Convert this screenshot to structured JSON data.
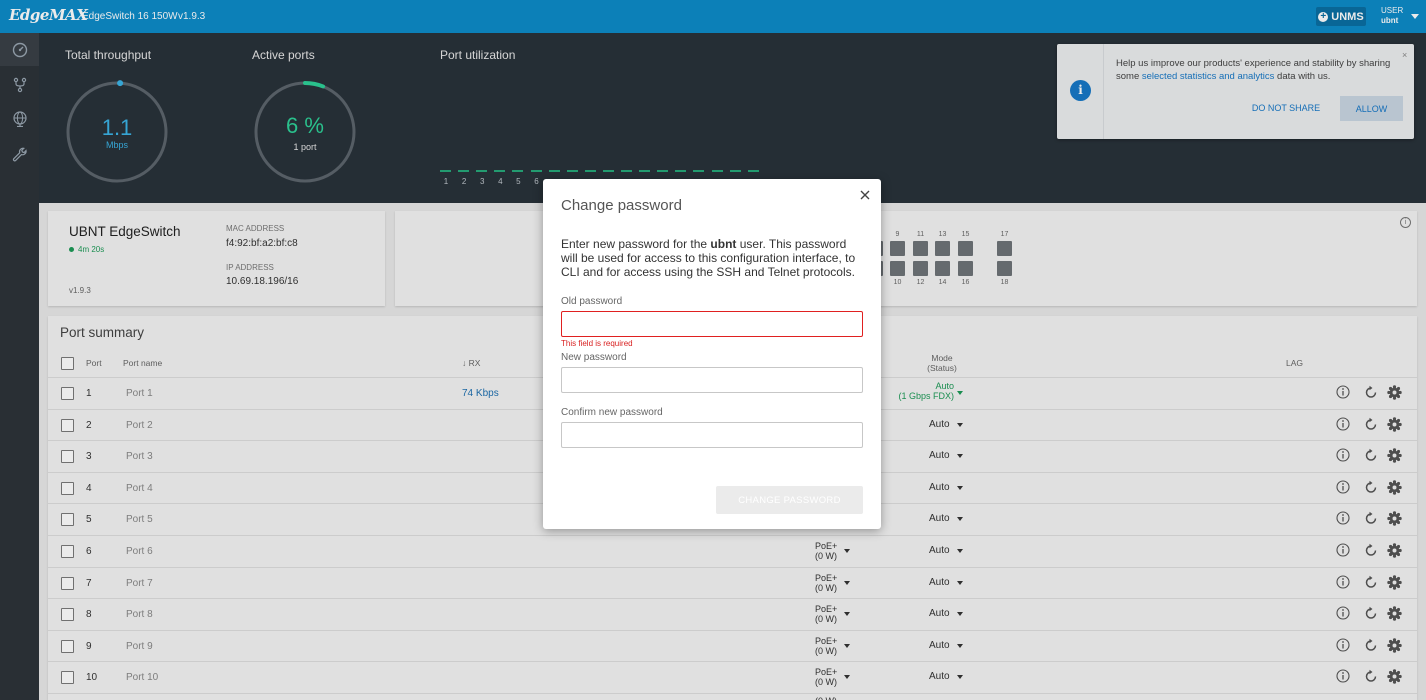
{
  "header": {
    "logo": "EdgeMAX",
    "model": "EdgeSwitch 16 150W",
    "version": "v1.9.3",
    "unms_label": "UNMS",
    "user_label": "USER",
    "username": "ubnt"
  },
  "sidebar": {
    "items": [
      {
        "icon": "dashboard-gauge-icon",
        "active": true
      },
      {
        "icon": "network-branch-icon",
        "active": false
      },
      {
        "icon": "globe-icon",
        "active": false
      },
      {
        "icon": "wrench-icon",
        "active": false
      }
    ]
  },
  "dashboard": {
    "throughput": {
      "title": "Total throughput",
      "value": "1.1",
      "unit": "Mbps",
      "fraction": 0.01
    },
    "active_ports": {
      "title": "Active ports",
      "value": "6 %",
      "sub": "1 port",
      "fraction": 0.06
    },
    "port_utilization": {
      "title": "Port utilization",
      "visible_ports": [
        "1",
        "2",
        "3",
        "4",
        "5",
        "6"
      ],
      "bar_count": 18
    }
  },
  "notification": {
    "text_before": "Help us improve our products' experience and stability by sharing some ",
    "link": "selected statistics and analytics",
    "text_after": " data with us.",
    "deny_label": "DO NOT SHARE",
    "allow_label": "ALLOW",
    "close": "×"
  },
  "device": {
    "name": "UBNT EdgeSwitch",
    "uptime": "4m 20s",
    "version": "v1.9.3",
    "mac_label": "MAC ADDRESS",
    "mac": "f4:92:bf:a2:bf:c8",
    "ip_label": "IP ADDRESS",
    "ip": "10.69.18.196/16"
  },
  "port_map": {
    "top_labels": [
      "9",
      "11",
      "13",
      "15",
      "17"
    ],
    "bottom_labels": [
      "10",
      "12",
      "14",
      "16",
      "18"
    ]
  },
  "port_summary": {
    "title": "Port summary",
    "columns": {
      "port": "Port",
      "name": "Port name",
      "rx": "↓ RX",
      "mode_line1": "Mode",
      "mode_line2": "(Status)",
      "lag": "LAG"
    },
    "rows": [
      {
        "port": "1",
        "name": "Port 1",
        "rx": "74 Kbps",
        "poe": "",
        "poe_w": "",
        "mode": "Auto",
        "mode_status": "(1 Gbps FDX)"
      },
      {
        "port": "2",
        "name": "Port 2",
        "rx": "",
        "poe": "",
        "poe_w": "",
        "mode": "Auto",
        "mode_status": ""
      },
      {
        "port": "3",
        "name": "Port 3",
        "rx": "",
        "poe": "",
        "poe_w": "",
        "mode": "Auto",
        "mode_status": ""
      },
      {
        "port": "4",
        "name": "Port 4",
        "rx": "",
        "poe": "",
        "poe_w": "",
        "mode": "Auto",
        "mode_status": ""
      },
      {
        "port": "5",
        "name": "Port 5",
        "rx": "",
        "poe": "",
        "poe_w": "",
        "mode": "Auto",
        "mode_status": ""
      },
      {
        "port": "6",
        "name": "Port 6",
        "rx": "",
        "poe": "PoE+",
        "poe_w": "(0 W)",
        "mode": "Auto",
        "mode_status": ""
      },
      {
        "port": "7",
        "name": "Port 7",
        "rx": "",
        "poe": "PoE+",
        "poe_w": "(0 W)",
        "mode": "Auto",
        "mode_status": ""
      },
      {
        "port": "8",
        "name": "Port 8",
        "rx": "",
        "poe": "PoE+",
        "poe_w": "(0 W)",
        "mode": "Auto",
        "mode_status": ""
      },
      {
        "port": "9",
        "name": "Port 9",
        "rx": "",
        "poe": "PoE+",
        "poe_w": "(0 W)",
        "mode": "Auto",
        "mode_status": ""
      },
      {
        "port": "10",
        "name": "Port 10",
        "rx": "",
        "poe": "PoE+",
        "poe_w": "(0 W)",
        "mode": "Auto",
        "mode_status": ""
      }
    ],
    "partial_next_row_poe": "(0 W)"
  },
  "modal": {
    "title": "Change password",
    "desc_before": "Enter new password for the ",
    "desc_user": "ubnt",
    "desc_after": " user. This password will be used for access to this configuration interface, to CLI and for access using the SSH and Telnet protocols.",
    "old_label": "Old password",
    "old_value": "",
    "error": "This field is required",
    "new_label": "New password",
    "new_value": "",
    "confirm_label": "Confirm new password",
    "confirm_value": "",
    "submit_label": "CHANGE PASSWORD"
  },
  "colors": {
    "brand_blue": "#0e8bc8",
    "dashboard_bg": "#29323a",
    "throughput_accent": "#3bb3e6",
    "ports_accent": "#2ed198",
    "ok_green": "#1d9a57",
    "error_red": "#e02020",
    "link_blue": "#1778c7"
  }
}
